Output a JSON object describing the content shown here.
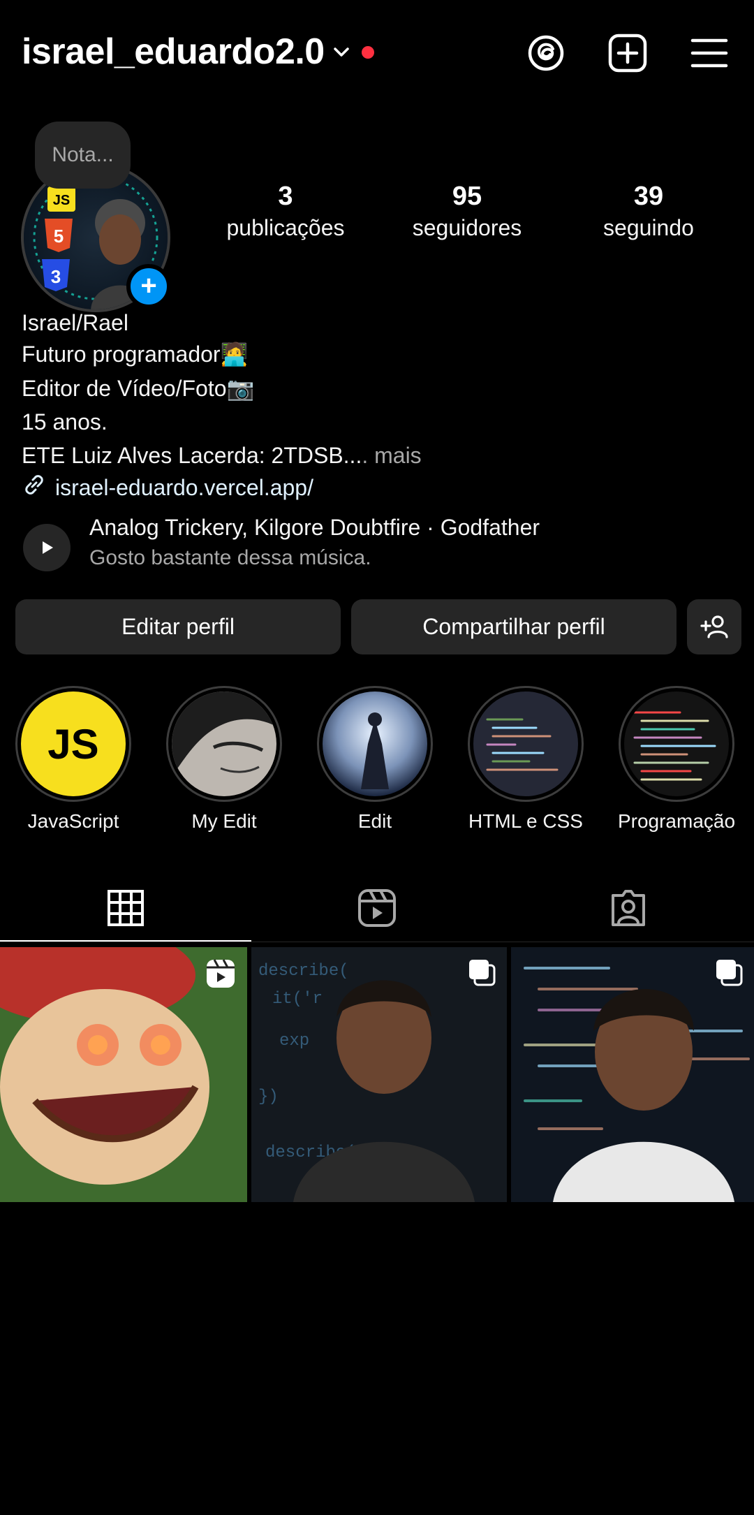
{
  "header": {
    "username": "israel_eduardo2.0",
    "icons": [
      "chevron-down-icon",
      "threads-icon",
      "new-post-icon",
      "menu-icon"
    ],
    "notification_dot_color": "#ff3040"
  },
  "profile": {
    "note_placeholder": "Nota...",
    "stats": [
      {
        "count": "3",
        "label": "publicações"
      },
      {
        "count": "95",
        "label": "seguidores"
      },
      {
        "count": "39",
        "label": "seguindo"
      }
    ],
    "name": "Israel/Rael",
    "bio_lines": [
      "Futuro programador🧑‍💻",
      "Editor de Vídeo/Foto📷",
      "15 anos."
    ],
    "bio_truncated": "ETE Luiz Alves Lacerda: 2TDSB...",
    "more_label": ". mais",
    "link": "israel-eduardo.vercel.app/",
    "music": {
      "title": "Analog Trickery, Kilgore Doubtfire · Godfather",
      "caption": "Gosto bastante dessa música."
    }
  },
  "actions": {
    "edit": "Editar perfil",
    "share": "Compartilhar perfil"
  },
  "highlights": [
    {
      "label": "JavaScript"
    },
    {
      "label": "My Edit"
    },
    {
      "label": "Edit"
    },
    {
      "label": "HTML e CSS"
    },
    {
      "label": "Programação"
    }
  ],
  "highlight_js_text": "JS",
  "tabs": [
    "grid-icon",
    "reels-icon",
    "tagged-icon"
  ],
  "colors": {
    "accent": "#0095f6",
    "button_bg": "#262626",
    "js_yellow": "#f7df1e"
  }
}
